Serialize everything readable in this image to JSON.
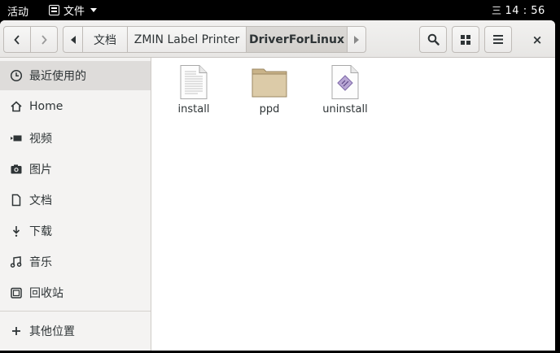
{
  "topbar": {
    "activities": "活动",
    "app_menu": "文件",
    "clock": "14 : 56",
    "clock_icon": "三"
  },
  "navigation": {
    "back_icon": "chevron-left-icon",
    "forward_icon": "chevron-right-icon"
  },
  "pathbar": {
    "crumbs": [
      "文档",
      "ZMIN Label Printer",
      "DriverForLinux"
    ]
  },
  "toolbar": {
    "search_icon": "search-icon",
    "view_icon": "grid-view-icon",
    "menu_icon": "hamburger-menu-icon",
    "close_label": "×"
  },
  "sidebar": {
    "items": [
      {
        "label": "最近使用的",
        "icon": "clock-icon",
        "selected": true
      },
      {
        "label": "Home",
        "icon": "home-icon"
      },
      {
        "label": "视频",
        "icon": "video-icon"
      },
      {
        "label": "图片",
        "icon": "camera-icon"
      },
      {
        "label": "文档",
        "icon": "document-icon"
      },
      {
        "label": "下载",
        "icon": "download-icon"
      },
      {
        "label": "音乐",
        "icon": "music-icon"
      },
      {
        "label": "回收站",
        "icon": "trash-icon"
      },
      {
        "label": "其他位置",
        "icon": "plus-icon"
      }
    ]
  },
  "files": [
    {
      "name": "install",
      "icon": "text-file-icon"
    },
    {
      "name": "ppd",
      "icon": "folder-icon"
    },
    {
      "name": "uninstall",
      "icon": "script-file-icon"
    }
  ],
  "colors": {
    "selected_bg": "#dedcda",
    "sidebar_bg": "#f4f3f2",
    "folder": "#d8c7a5"
  }
}
